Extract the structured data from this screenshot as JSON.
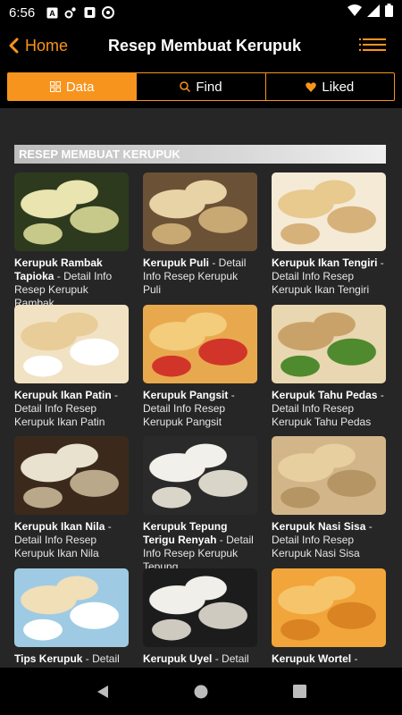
{
  "status_bar": {
    "time": "6:56",
    "icons": [
      "a-notification-icon",
      "settings-notification-icon",
      "shield-notification-icon",
      "vpn-notification-icon",
      "wifi-icon",
      "signal-icon",
      "battery-icon"
    ]
  },
  "app_bar": {
    "back_label": "Home",
    "title": "Resep Membuat Kerupuk"
  },
  "tabs": [
    {
      "label": "Data",
      "icon": "grid-icon",
      "active": true
    },
    {
      "label": "Find",
      "icon": "search-icon",
      "active": false
    },
    {
      "label": "Liked",
      "icon": "heart-icon",
      "active": false
    }
  ],
  "section": {
    "title": "RESEP MEMBUAT KERUPUK"
  },
  "recipes": [
    {
      "name": "Kerupuk Rambak Tapioka",
      "detail": " - Detail Info Resep Kerupuk Rambak",
      "colors": [
        "#2d3a1e",
        "#e9e4b0",
        "#c7c98a"
      ]
    },
    {
      "name": "Kerupuk Puli",
      "detail": " - Detail Info Resep Kerupuk Puli",
      "colors": [
        "#6b5136",
        "#e8d3a6",
        "#c8a873"
      ]
    },
    {
      "name": "Kerupuk Ikan Tengiri",
      "detail": " - Detail Info Resep Kerupuk Ikan Tengiri",
      "colors": [
        "#f4ead6",
        "#e8c98e",
        "#d6b27a"
      ]
    },
    {
      "name": "Kerupuk Ikan Patin",
      "detail": " - Detail Info Resep Kerupuk Ikan Patin",
      "colors": [
        "#f2e2c4",
        "#e9cd98",
        "#ffffff"
      ]
    },
    {
      "name": "Kerupuk Pangsit",
      "detail": " - Detail Info Resep Kerupuk Pangsit",
      "colors": [
        "#e8a94e",
        "#f3cc7c",
        "#d1352a"
      ]
    },
    {
      "name": "Kerupuk Tahu Pedas",
      "detail": " - Detail Info Resep Kerupuk Tahu Pedas",
      "colors": [
        "#e9d7b1",
        "#c9a26a",
        "#4f8a2e"
      ]
    },
    {
      "name": "Kerupuk Ikan Nila",
      "detail": " - Detail Info Resep Kerupuk Ikan Nila",
      "colors": [
        "#3b2a1c",
        "#e9e2cf",
        "#b9a98a"
      ]
    },
    {
      "name": "Kerupuk Tepung Terigu Renyah",
      "detail": " - Detail Info Resep Kerupuk Tepung",
      "colors": [
        "#2a2a2a",
        "#f2f0ea",
        "#d9d5c9"
      ]
    },
    {
      "name": "Kerupuk Nasi Sisa",
      "detail": " - Detail Info Resep Kerupuk Nasi Sisa",
      "colors": [
        "#d2b68a",
        "#e8cf9f",
        "#b59564"
      ]
    },
    {
      "name": "Tips Kerupuk",
      "detail": " - Detail Info Resep Tips",
      "colors": [
        "#9ecbe3",
        "#f1dfb8",
        "#ffffff"
      ]
    },
    {
      "name": "Kerupuk Uyel",
      "detail": " - Detail Info Resep Kerupuk Uyel",
      "colors": [
        "#1c1c1c",
        "#f0efea",
        "#cfcac0"
      ]
    },
    {
      "name": "Kerupuk Wortel",
      "detail": " - Detail Info Resep Kerupuk Wortel",
      "colors": [
        "#f2a53a",
        "#f6c46a",
        "#d98322"
      ]
    }
  ],
  "nav_bar": {
    "buttons": [
      "back-nav-icon",
      "home-nav-icon",
      "recents-nav-icon"
    ]
  },
  "theme": {
    "accent": "#f7941d",
    "background": "#262626",
    "bar": "#000000"
  }
}
